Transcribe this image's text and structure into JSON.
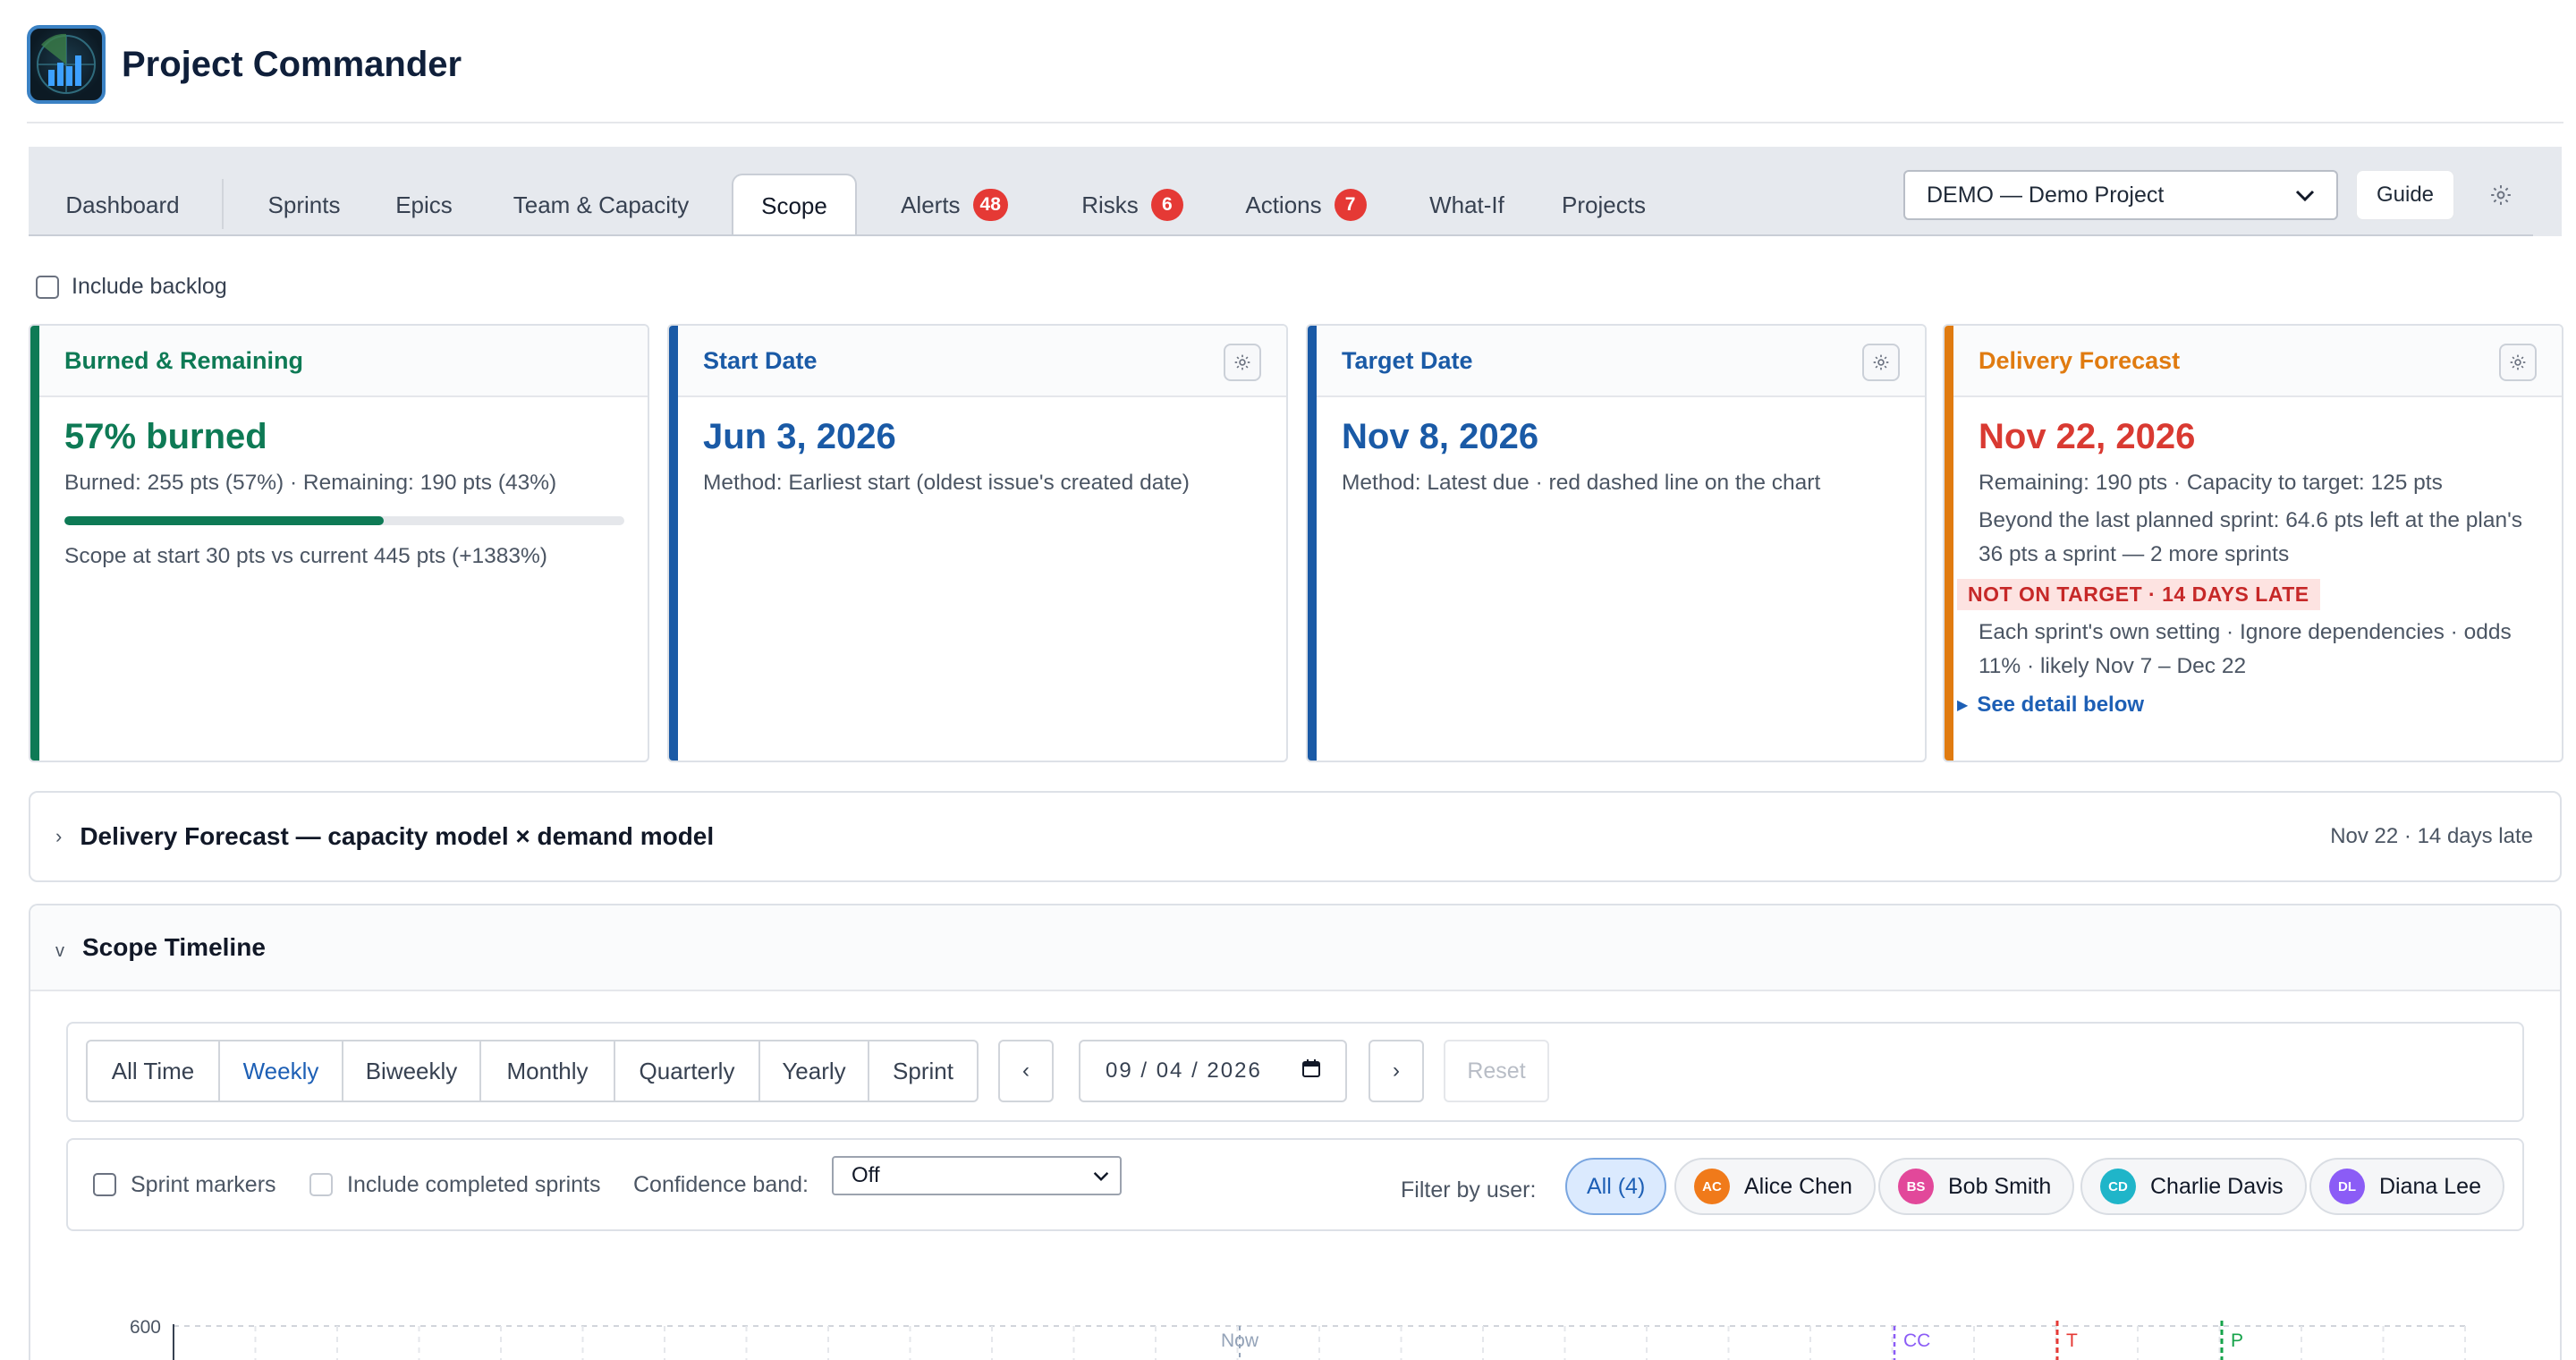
{
  "app": {
    "title": "Project Commander"
  },
  "tabs": [
    {
      "label": "Dashboard"
    },
    {
      "label": "Sprints"
    },
    {
      "label": "Epics"
    },
    {
      "label": "Team & Capacity"
    },
    {
      "label": "Scope",
      "active": true
    },
    {
      "label": "Alerts",
      "badge": "48"
    },
    {
      "label": "Risks",
      "badge": "6"
    },
    {
      "label": "Actions",
      "badge": "7"
    },
    {
      "label": "What-If"
    },
    {
      "label": "Projects"
    }
  ],
  "project_select": {
    "value": "DEMO — Demo Project"
  },
  "guide_label": "Guide",
  "backlog_label": "Include backlog",
  "cards": {
    "burned": {
      "title": "Burned & Remaining",
      "value": "57% burned",
      "line1": "Burned: 255 pts (57%) · Remaining: 190 pts (43%)",
      "progress": 0.57,
      "line2": "Scope at start 30 pts vs current 445 pts (+1383%)",
      "color": "#0e7a55"
    },
    "start": {
      "title": "Start Date",
      "value": "Jun 3, 2026",
      "line1": "Method: Earliest start (oldest issue's created date)",
      "color": "#1a5aa6"
    },
    "target": {
      "title": "Target Date",
      "value": "Nov 8, 2026",
      "line1": "Method: Latest due · red dashed line on the chart",
      "color": "#1a5aa6"
    },
    "forecast": {
      "title": "Delivery Forecast",
      "value": "Nov 22, 2026",
      "line1": "Remaining: 190 pts · Capacity to target: 125 pts",
      "line2": "Beyond the last planned sprint: 64.6 pts left at the plan's 36 pts a sprint — 2 more sprints",
      "status": "NOT ON TARGET · 14 DAYS LATE",
      "line3": "Each sprint's own setting · Ignore dependencies · odds 11% · likely Nov 7 – Dec 22",
      "link": "See detail below",
      "title_color": "#e07b10",
      "value_color": "#d93a32"
    }
  },
  "forecast_panel": {
    "title": "Delivery Forecast — capacity model × demand model",
    "summary": "Nov 22 · 14 days late"
  },
  "timeline": {
    "title": "Scope Timeline",
    "periods": [
      "All Time",
      "Weekly",
      "Biweekly",
      "Monthly",
      "Quarterly",
      "Yearly",
      "Sprint"
    ],
    "active_period": "Weekly",
    "prev": "‹",
    "next": "›",
    "date": "09 / 04 / 2026",
    "reset": "Reset",
    "options": {
      "sprint_markers": "Sprint markers",
      "include_completed": "Include completed sprints",
      "confidence_label": "Confidence band:",
      "confidence_value": "Off"
    },
    "filter_label": "Filter by user:",
    "users": [
      {
        "label": "All (4)",
        "active": true
      },
      {
        "initials": "AC",
        "name": "Alice Chen",
        "color": "#f07a1a"
      },
      {
        "initials": "BS",
        "name": "Bob Smith",
        "color": "#e2489a"
      },
      {
        "initials": "CD",
        "name": "Charlie Davis",
        "color": "#1fb5c9"
      },
      {
        "initials": "DL",
        "name": "Diana Lee",
        "color": "#8b5cf6"
      }
    ]
  },
  "chart_data": {
    "type": "line",
    "y_tick_top": "600",
    "markers": [
      {
        "label": "Now",
        "color": "#94a3b8"
      },
      {
        "label": "CC",
        "color": "#8b5cf6"
      },
      {
        "label": "T",
        "color": "#e53935"
      },
      {
        "label": "P",
        "color": "#16a34a"
      }
    ]
  }
}
